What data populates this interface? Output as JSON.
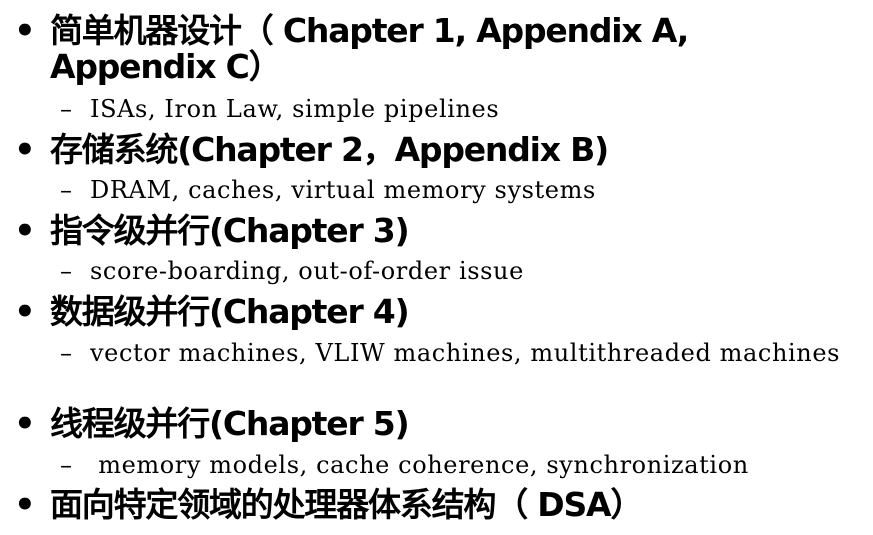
{
  "bullets": [
    {
      "text": "简单机器设计（ Chapter 1, Appendix A, Appendix C）",
      "sub": "ISAs, Iron Law, simple pipelines"
    },
    {
      "text": "存储系统(Chapter 2，Appendix B)",
      "sub": "DRAM, caches, virtual memory systems"
    },
    {
      "text": "指令级并行(Chapter 3)",
      "sub": "score-boarding, out-of-order issue"
    },
    {
      "text": "数据级并行(Chapter 4)",
      "sub": "vector machines, VLIW machines, multithreaded machines"
    },
    {
      "text": "线程级并行(Chapter 5)",
      "sub": " memory models, cache coherence, synchronization"
    },
    {
      "text": "面向特定领域的处理器体系结构（ DSA）"
    }
  ],
  "symbols": {
    "bullet": "•",
    "dash": "–"
  }
}
